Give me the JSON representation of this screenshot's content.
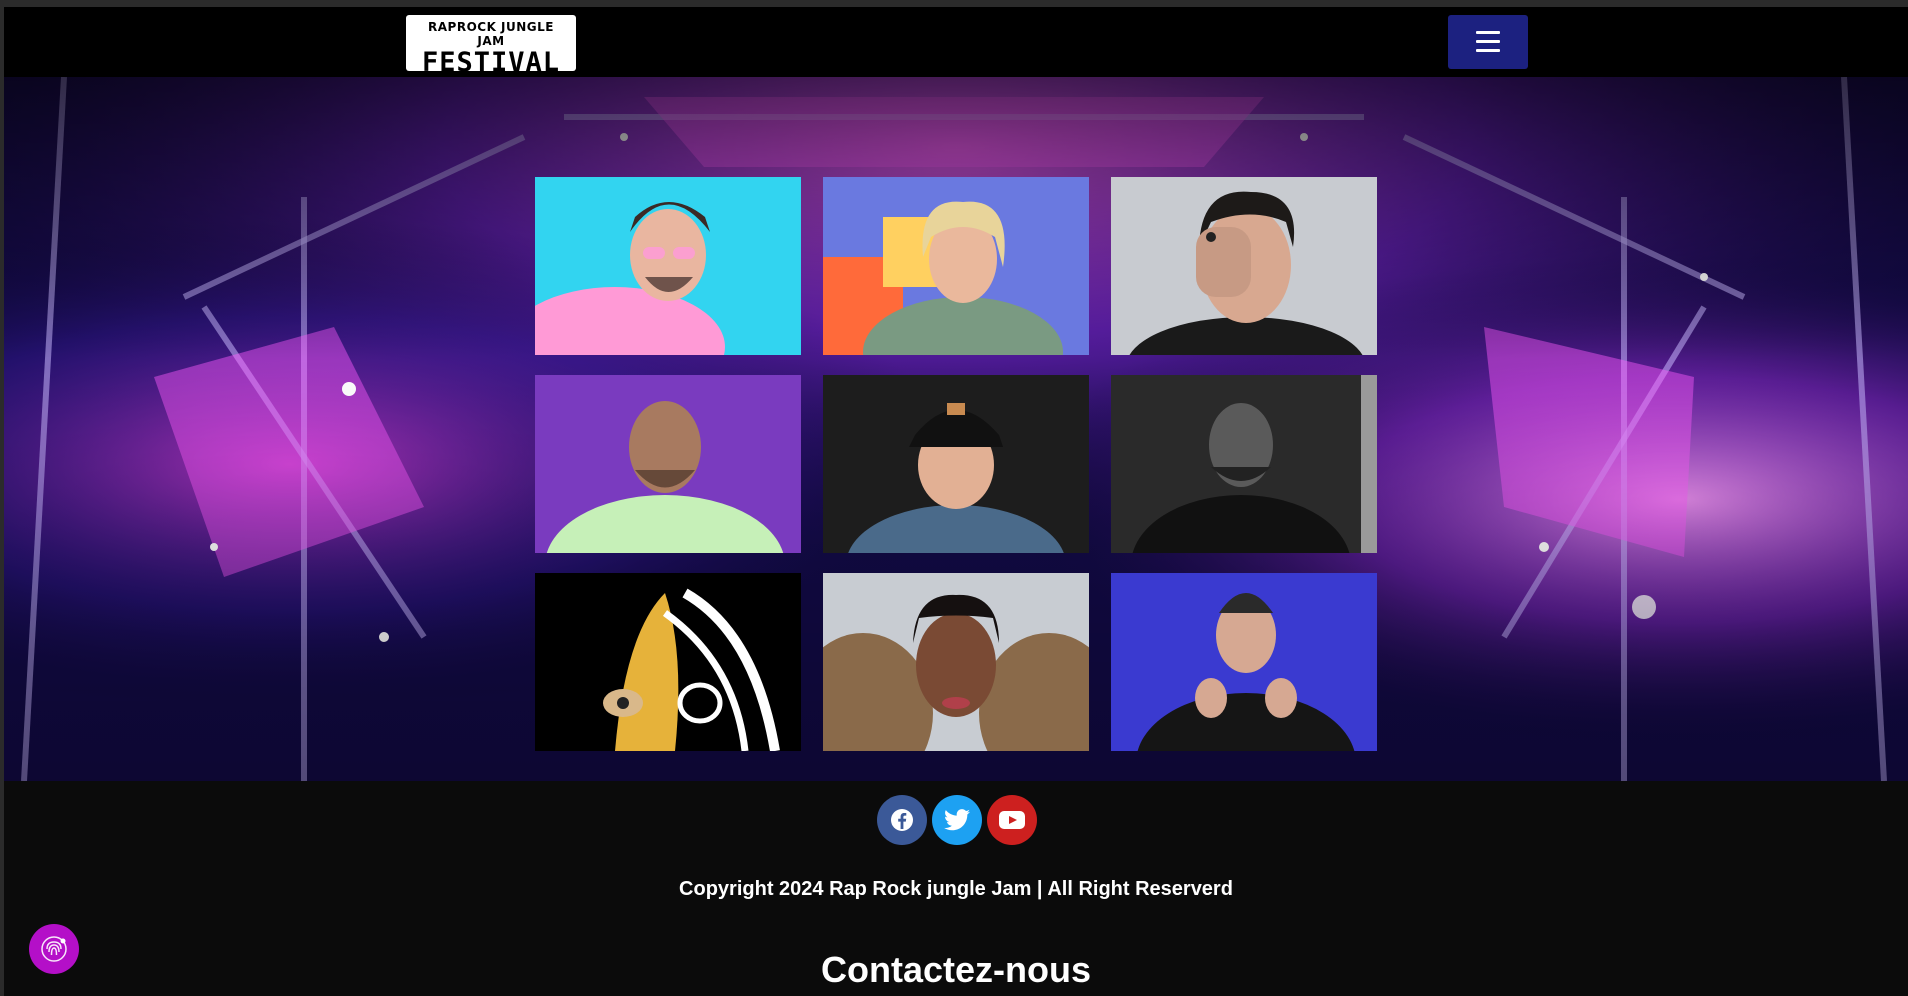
{
  "header": {
    "logo_line1": "RAPROCK JUNGLE JAM",
    "logo_line2": "FESTIVAL",
    "menu_icon": "hamburger-icon",
    "menu_button_color": "#1c2180"
  },
  "hero": {
    "background": "concert-stage-lights",
    "colors": {
      "magenta": "#e23be0",
      "violet": "#6a2bd9",
      "deep_blue": "#0a0630"
    }
  },
  "artists": [
    {
      "image": "artist-portrait-1"
    },
    {
      "image": "artist-portrait-2"
    },
    {
      "image": "artist-portrait-3"
    },
    {
      "image": "artist-portrait-4"
    },
    {
      "image": "artist-portrait-5"
    },
    {
      "image": "artist-portrait-6"
    },
    {
      "image": "artist-artwork-7"
    },
    {
      "image": "artist-portrait-8"
    },
    {
      "image": "artist-portrait-9"
    }
  ],
  "footer": {
    "social": [
      {
        "name": "facebook",
        "icon": "facebook-icon",
        "color": "#3b5998"
      },
      {
        "name": "twitter",
        "icon": "twitter-icon",
        "color": "#1da1f2"
      },
      {
        "name": "youtube",
        "icon": "youtube-icon",
        "color": "#cd201f"
      }
    ],
    "copyright": "Copyright 2024 Rap Rock jungle Jam | All Right Reserverd",
    "contact_heading": "Contactez-nous"
  },
  "cookie_button": {
    "icon": "cookie-fingerprint-icon",
    "color": "#b40fc8"
  }
}
